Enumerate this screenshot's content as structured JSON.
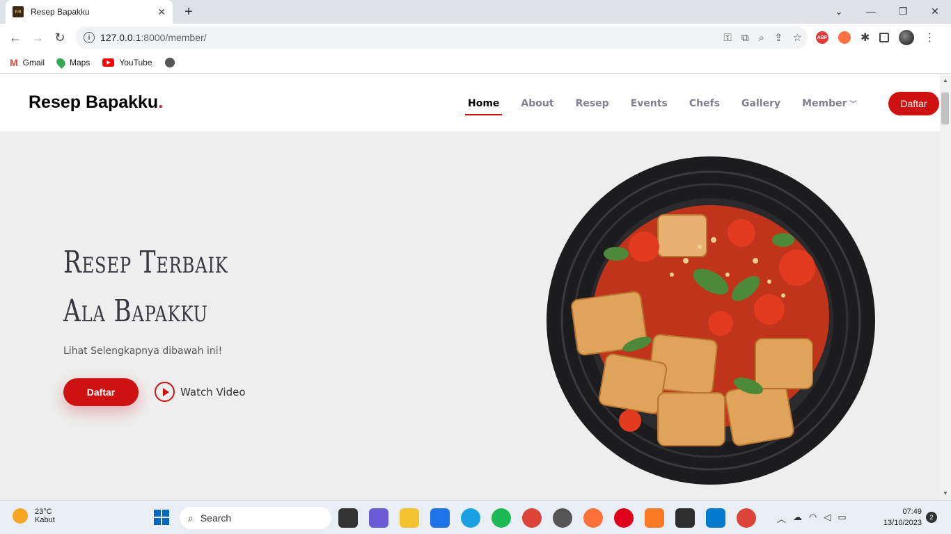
{
  "browser": {
    "tab_title": "Resep Bapakku",
    "tab_favicon_text": "RB",
    "url_host": "127.0.0.1",
    "url_path": ":8000/member/",
    "bookmarks": [
      {
        "label": "Gmail",
        "icon": "gmail-icon"
      },
      {
        "label": "Maps",
        "icon": "maps-icon"
      },
      {
        "label": "YouTube",
        "icon": "youtube-icon"
      }
    ]
  },
  "site": {
    "logo": "Resep Bapakku",
    "logo_dot": ".",
    "nav": [
      {
        "label": "Home",
        "active": true
      },
      {
        "label": "About"
      },
      {
        "label": "Resep"
      },
      {
        "label": "Events"
      },
      {
        "label": "Chefs"
      },
      {
        "label": "Gallery"
      },
      {
        "label": "Member",
        "has_dropdown": true
      }
    ],
    "header_cta": "Daftar",
    "accent_color": "#ce1212"
  },
  "hero": {
    "title_line1": "Resep Terbaik",
    "title_line2": "Ala Bapakku",
    "subtitle": "Lihat Selengkapnya dibawah ini!",
    "primary_button": "Daftar",
    "watch_label": "Watch Video"
  },
  "taskbar": {
    "temperature": "23°C",
    "weather": "Kabut",
    "search_placeholder": "Search",
    "time": "07:49",
    "date": "13/10/2023",
    "notifications": "2"
  }
}
